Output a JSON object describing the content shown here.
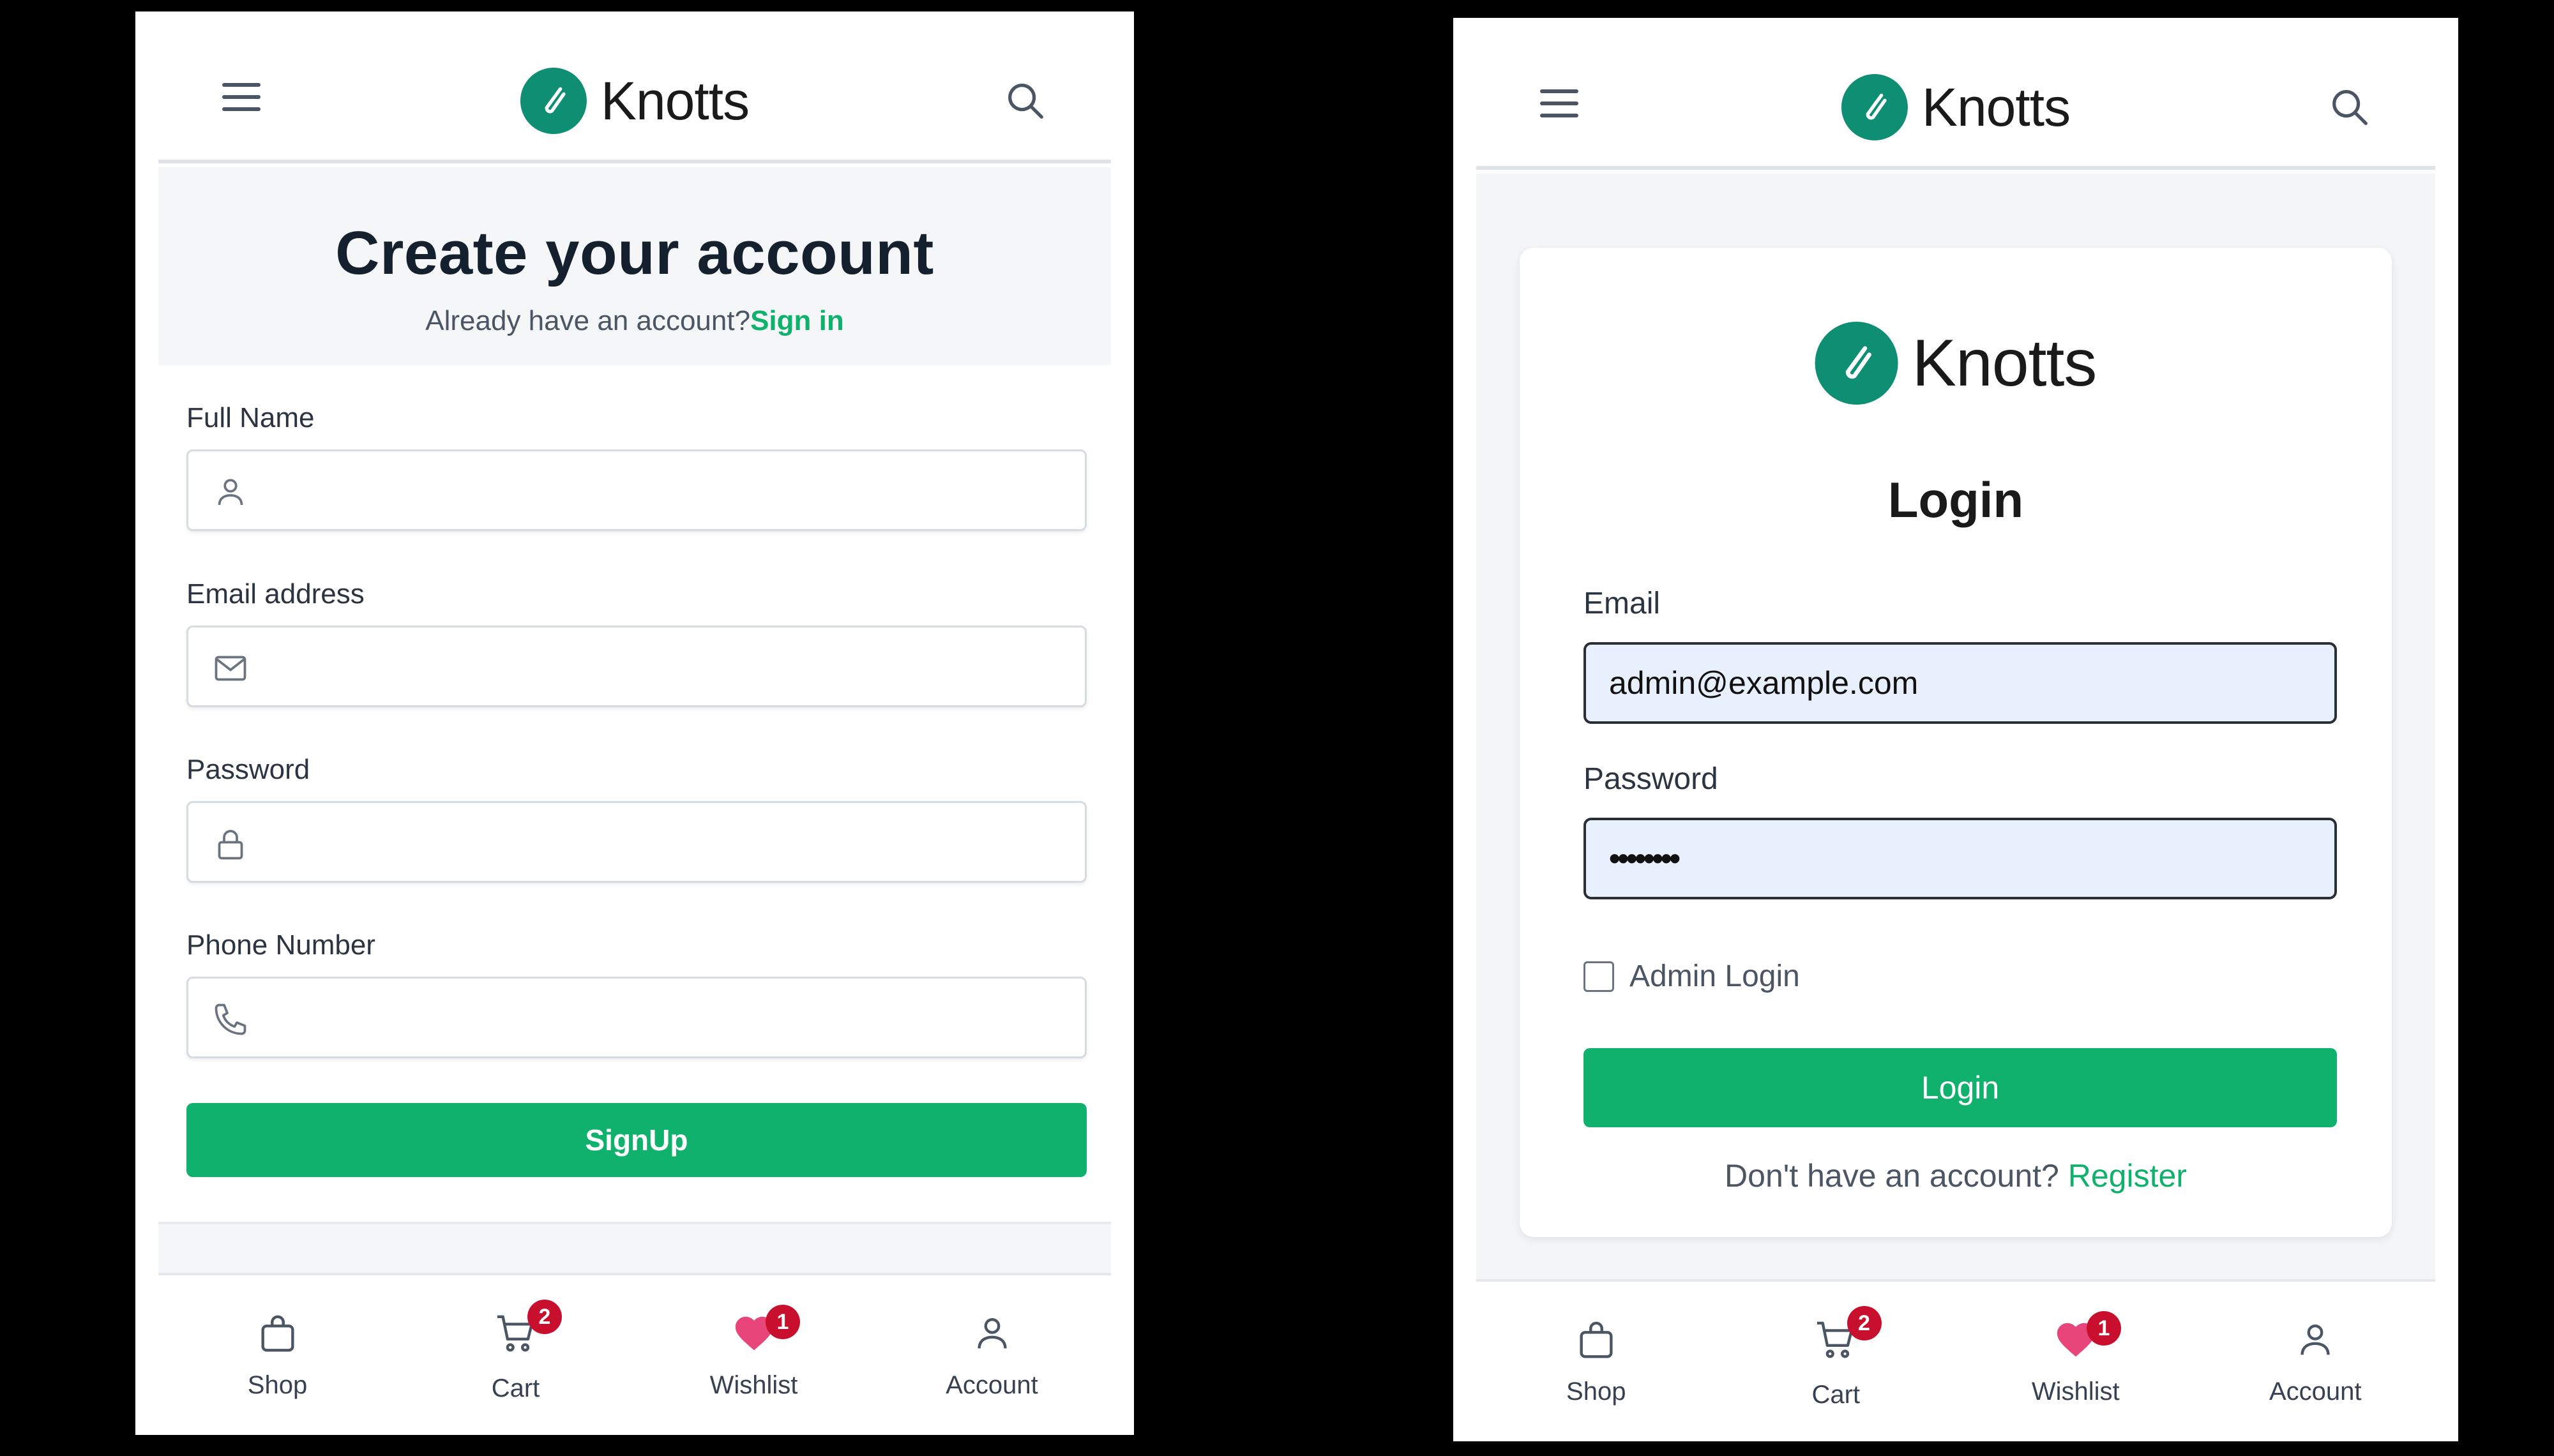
{
  "brand": {
    "name": "Knotts",
    "color": "#0e8f73",
    "accent": "#10b16d"
  },
  "signup": {
    "title": "Create your account",
    "subtitle": "Already have an account?",
    "signin_link": "Sign in",
    "fields": [
      {
        "label": "Full Name",
        "icon": "user-icon"
      },
      {
        "label": "Email address",
        "icon": "mail-icon"
      },
      {
        "label": "Password",
        "icon": "lock-icon"
      },
      {
        "label": "Phone Number",
        "icon": "phone-icon"
      }
    ],
    "submit_label": "SignUp"
  },
  "login": {
    "title": "Login",
    "email_label": "Email",
    "email_value": "admin@example.com",
    "password_label": "Password",
    "password_value": "••••••••",
    "admin_checkbox_label": "Admin Login",
    "submit_label": "Login",
    "register_prompt": "Don't have an account?",
    "register_link": "Register"
  },
  "nav": {
    "shop": "Shop",
    "cart": "Cart",
    "cart_count": "2",
    "wishlist": "Wishlist",
    "wishlist_count": "1",
    "account": "Account"
  }
}
